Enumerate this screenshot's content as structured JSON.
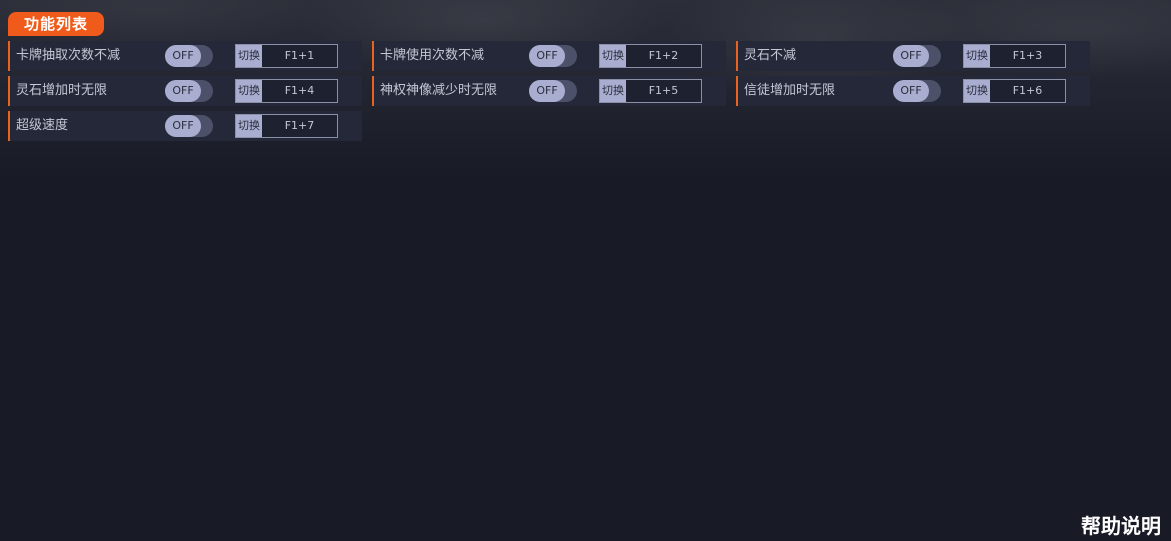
{
  "section": {
    "title": "功能列表"
  },
  "features": [
    {
      "label": "卡牌抽取次数不减",
      "state": "OFF",
      "switch_label": "切换",
      "hotkey": "F1+1"
    },
    {
      "label": "卡牌使用次数不减",
      "state": "OFF",
      "switch_label": "切换",
      "hotkey": "F1+2"
    },
    {
      "label": "灵石不减",
      "state": "OFF",
      "switch_label": "切换",
      "hotkey": "F1+3"
    },
    {
      "label": "灵石增加时无限",
      "state": "OFF",
      "switch_label": "切换",
      "hotkey": "F1+4"
    },
    {
      "label": "神权神像减少时无限",
      "state": "OFF",
      "switch_label": "切换",
      "hotkey": "F1+5"
    },
    {
      "label": "信徒增加时无限",
      "state": "OFF",
      "switch_label": "切换",
      "hotkey": "F1+6"
    },
    {
      "label": "超级速度",
      "state": "OFF",
      "switch_label": "切换",
      "hotkey": "F1+7"
    }
  ],
  "help": {
    "label": "帮助说明"
  },
  "colors": {
    "accent": "#f05a1a",
    "row_bg": "#252838",
    "toggle_knob": "#a9aed0",
    "page_bg": "#181b26"
  }
}
